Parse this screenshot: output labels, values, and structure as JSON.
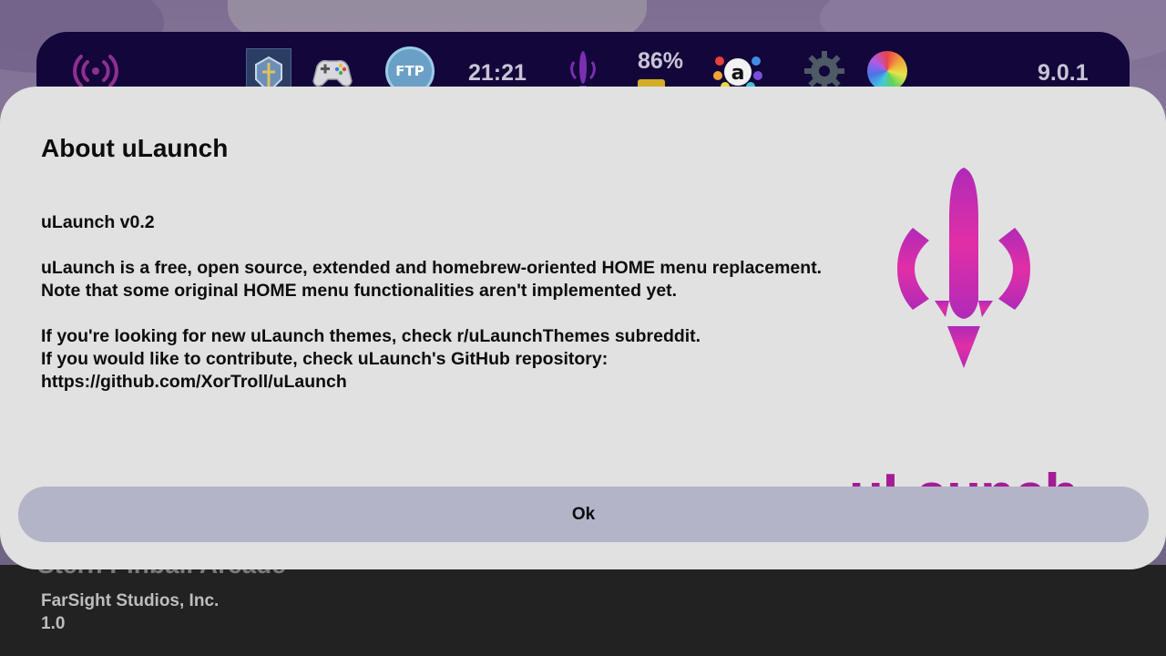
{
  "topbar": {
    "time": "21:21",
    "battery": "86%",
    "firmware_version": "9.0.1",
    "ftp_label": "FTP",
    "icons": [
      "wifi-icon",
      "game-icon",
      "controller-icon",
      "ftp-icon",
      "rocket-icon",
      "battery-icon",
      "album-icon",
      "gear-icon",
      "color-wheel-icon"
    ]
  },
  "background_app": {
    "title": "Stern Pinball Arcade",
    "developer": "FarSight Studios, Inc.",
    "version": "1.0"
  },
  "dialog": {
    "title": "About uLaunch",
    "lines": [
      "uLaunch v0.2",
      "",
      "uLaunch is a free, open source, extended and homebrew-oriented HOME menu replacement.",
      "Note that some original HOME menu functionalities aren't implemented yet.",
      "",
      "If you're looking for new uLaunch themes, check r/uLaunchThemes subreddit.",
      "If you would like to contribute, check uLaunch's GitHub repository:",
      "https://github.com/XorTroll/uLaunch"
    ],
    "logo_text": "uLaunch",
    "ok_label": "Ok"
  },
  "colors": {
    "topbar_bg": "#13063a",
    "dialog_bg": "#e1e1e1",
    "ok_button_bg": "#b3b4c8",
    "logo_purple": "#a51d94",
    "logo_pink": "#e62fa3"
  }
}
